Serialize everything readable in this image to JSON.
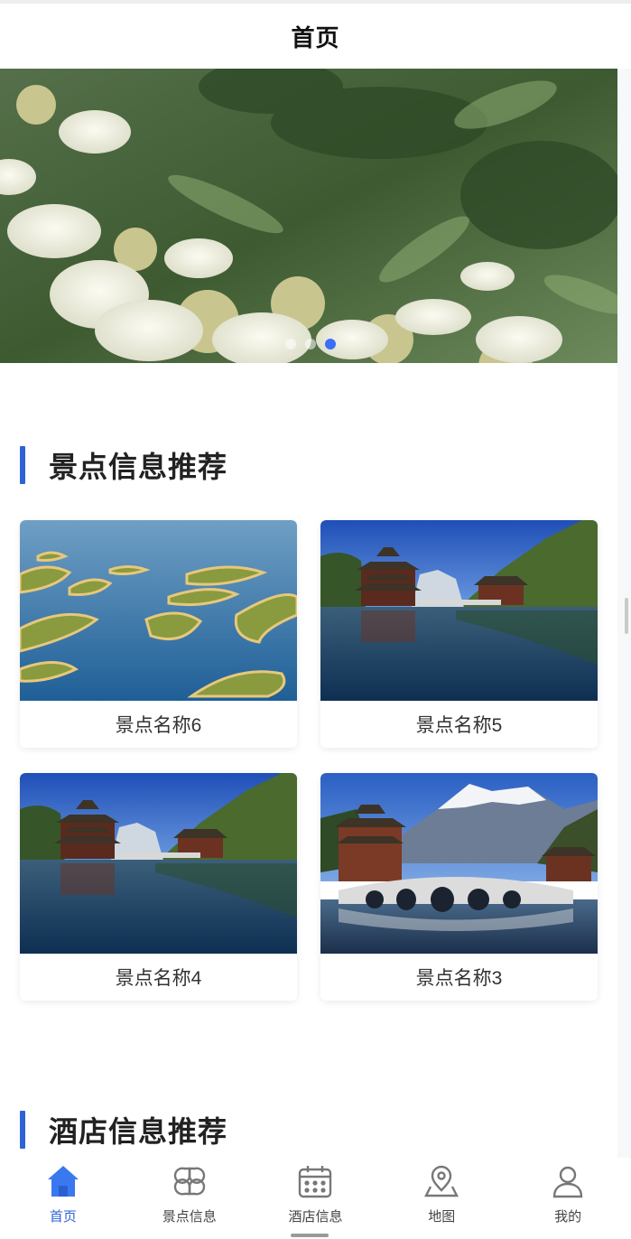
{
  "header": {
    "title": "首页"
  },
  "banner": {
    "slide_count": 3,
    "active_index": 2
  },
  "sections": {
    "attractions": {
      "title": "景点信息推荐"
    },
    "hotels": {
      "title": "酒店信息推荐"
    }
  },
  "attractions": [
    {
      "name": "景点名称6",
      "image": "lake-islands"
    },
    {
      "name": "景点名称5",
      "image": "pagoda-lake"
    },
    {
      "name": "景点名称4",
      "image": "pagoda-lake"
    },
    {
      "name": "景点名称3",
      "image": "pagoda-bridge-snow-mountain"
    }
  ],
  "tabbar": {
    "items": [
      {
        "label": "首页",
        "icon": "home-icon",
        "active": true
      },
      {
        "label": "景点信息",
        "icon": "grid-icon",
        "active": false
      },
      {
        "label": "酒店信息",
        "icon": "calendar-icon",
        "active": false
      },
      {
        "label": "地图",
        "icon": "map-pin-icon",
        "active": false
      },
      {
        "label": "我的",
        "icon": "user-icon",
        "active": false
      }
    ]
  },
  "colors": {
    "accent": "#2d63d6",
    "dot_active": "#3a6ff7"
  }
}
